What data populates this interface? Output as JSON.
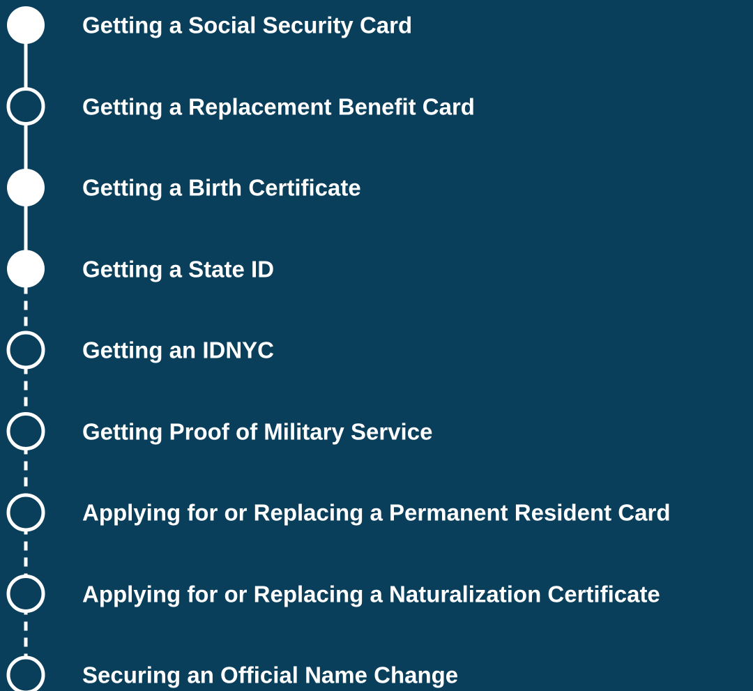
{
  "colors": {
    "background": "#0A3F5C",
    "foreground": "#FFFFFF"
  },
  "steps": [
    {
      "label": "Getting a Social Security Card",
      "status": "completed"
    },
    {
      "label": "Getting a Replacement Benefit Card",
      "status": "pending"
    },
    {
      "label": "Getting a Birth Certificate",
      "status": "completed"
    },
    {
      "label": "Getting a State ID",
      "status": "completed"
    },
    {
      "label": "Getting an IDNYC",
      "status": "pending"
    },
    {
      "label": "Getting Proof of Military Service",
      "status": "pending"
    },
    {
      "label": "Applying for or Replacing a Permanent Resident Card",
      "status": "pending"
    },
    {
      "label": "Applying for or Replacing a Naturalization Certificate",
      "status": "pending"
    },
    {
      "label": "Securing an Official Name Change",
      "status": "pending"
    }
  ]
}
